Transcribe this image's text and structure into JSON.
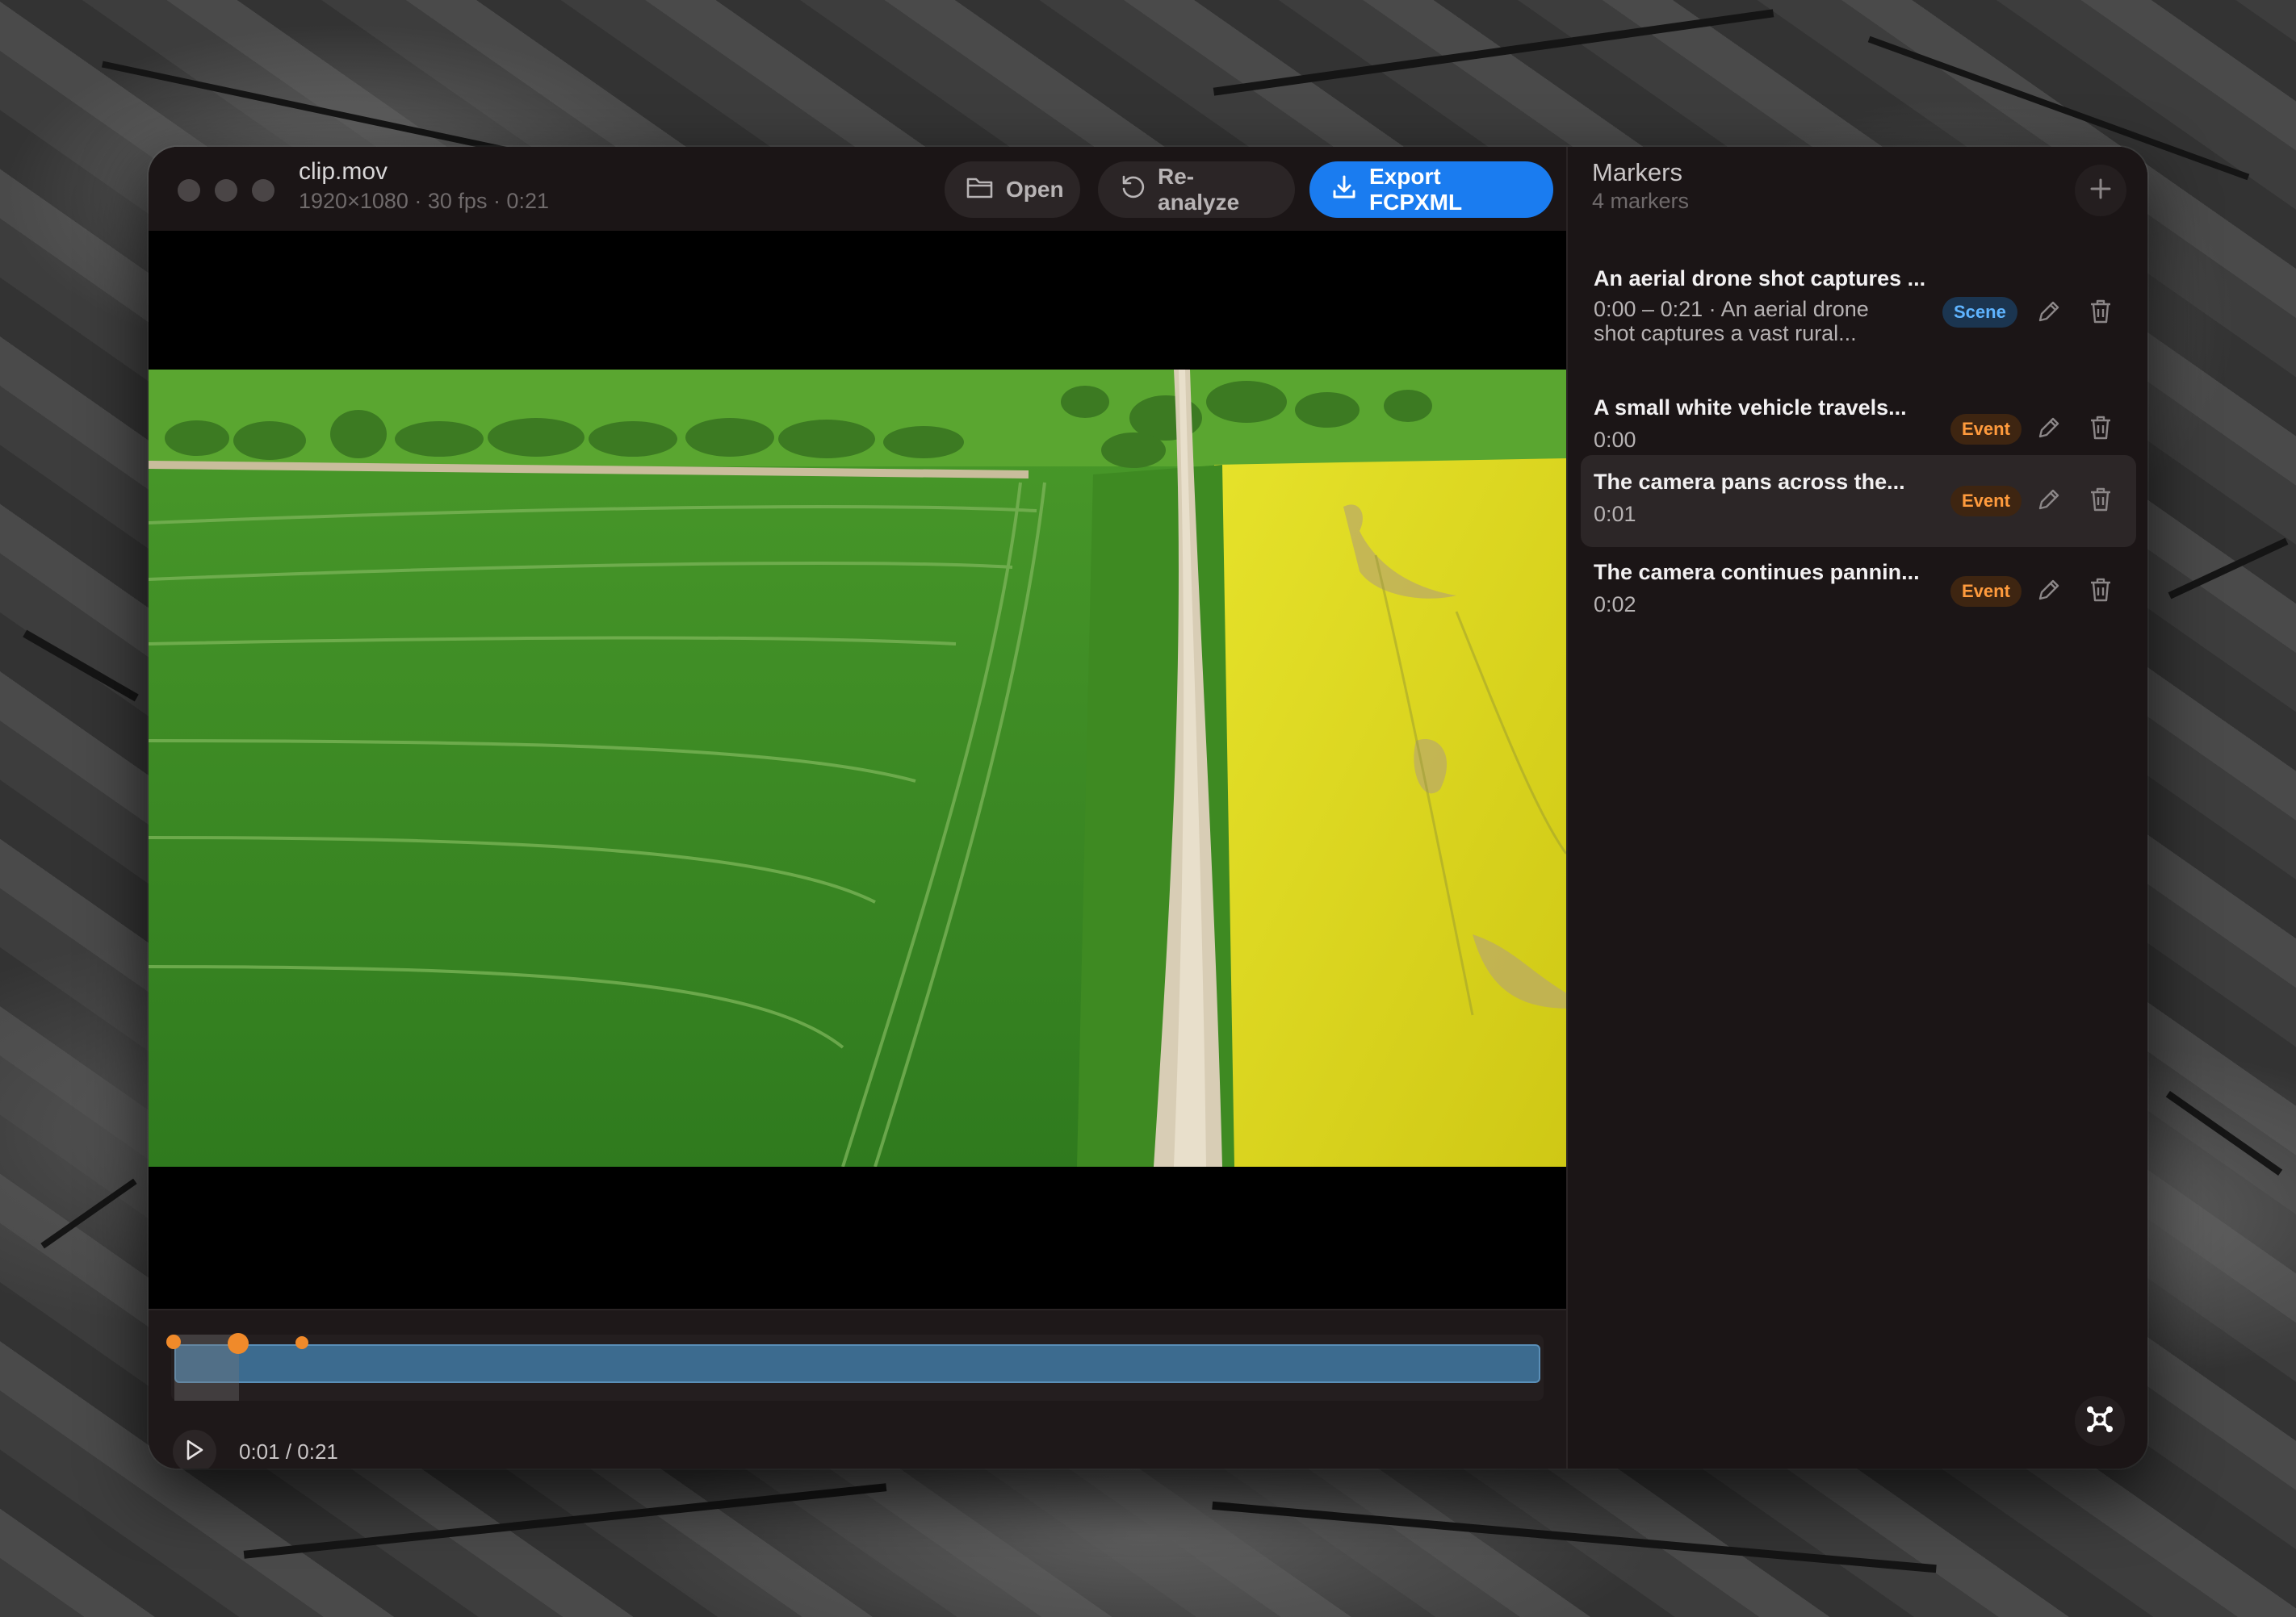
{
  "window": {
    "file_name": "clip.mov",
    "file_meta": "1920×1080 · 30 fps · 0:21"
  },
  "toolbar": {
    "open_label": "Open",
    "reanalyze_label": "Re-analyze",
    "export_label": "Export FCPXML"
  },
  "player": {
    "time_display": "0:01 / 0:21",
    "current_time": "0:01",
    "duration": "0:21",
    "progress": 0.048
  },
  "panel": {
    "title": "Markers",
    "count_label": "4 markers"
  },
  "markers": [
    {
      "title": "An aerial drone shot captures ...",
      "subtitle": "0:00 – 0:21 · An aerial drone shot captures a vast rural...",
      "badge": "Scene",
      "selected": false
    },
    {
      "title": "A small white vehicle travels...",
      "subtitle": "0:00",
      "badge": "Event",
      "selected": false
    },
    {
      "title": "The camera pans across the...",
      "subtitle": "0:01",
      "badge": "Event",
      "selected": true
    },
    {
      "title": "The camera continues pannin...",
      "subtitle": "0:02",
      "badge": "Event",
      "selected": false
    }
  ],
  "colors": {
    "accent": "#1a7cf0",
    "scene_badge": "#5fb4ff",
    "event_badge": "#ff9b3d",
    "timeline": "#3c6b8f",
    "marker_dot": "#f08a2a"
  },
  "icons": {
    "open": "folder-icon",
    "reanalyze": "refresh-icon",
    "export": "download-icon",
    "add": "plus-icon",
    "edit": "pencil-icon",
    "delete": "trash-icon",
    "play": "play-icon",
    "fit": "fit-screen-icon"
  }
}
